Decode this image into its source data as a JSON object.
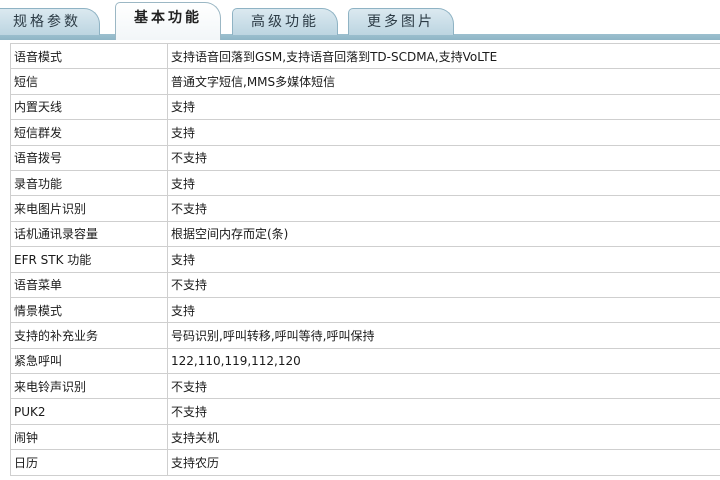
{
  "tabs": [
    {
      "label": "规格参数",
      "active": false
    },
    {
      "label": "基本功能",
      "active": true
    },
    {
      "label": "高级功能",
      "active": false
    },
    {
      "label": "更多图片",
      "active": false
    }
  ],
  "rows": [
    {
      "label": "语音模式",
      "value": "支持语音回落到GSM,支持语音回落到TD-SCDMA,支持VoLTE"
    },
    {
      "label": "短信",
      "value": "普通文字短信,MMS多媒体短信"
    },
    {
      "label": "内置天线",
      "value": "支持"
    },
    {
      "label": "短信群发",
      "value": "支持"
    },
    {
      "label": "语音拨号",
      "value": "不支持"
    },
    {
      "label": "录音功能",
      "value": "支持"
    },
    {
      "label": "来电图片识别",
      "value": "不支持"
    },
    {
      "label": "话机通讯录容量",
      "value": "根据空间内存而定(条)"
    },
    {
      "label": "EFR STK 功能",
      "value": "支持"
    },
    {
      "label": "语音菜单",
      "value": "不支持"
    },
    {
      "label": "情景模式",
      "value": "支持"
    },
    {
      "label": "支持的补充业务",
      "value": "号码识别,呼叫转移,呼叫等待,呼叫保持"
    },
    {
      "label": "紧急呼叫",
      "value": "122,110,119,112,120"
    },
    {
      "label": "来电铃声识别",
      "value": "不支持"
    },
    {
      "label": "PUK2",
      "value": "不支持"
    },
    {
      "label": "闹钟",
      "value": "支持关机"
    },
    {
      "label": "日历",
      "value": "支持农历"
    }
  ]
}
